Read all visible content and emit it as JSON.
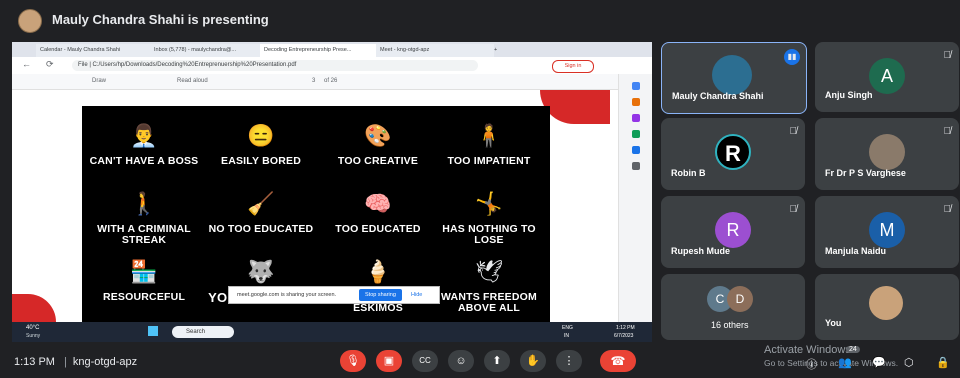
{
  "presenter": {
    "text": "Mauly Chandra Shahi is presenting"
  },
  "browser": {
    "tabs": [
      "Calendar - Mauly Chandra Shahi",
      "Inbox (5,778) - maulychandra@...",
      "Decoding Entrepreneurship Prese...",
      "Meet - kng-otgd-apz"
    ],
    "new_tab": "+",
    "url": "File  |  C:/Users/hp/Downloads/Decoding%20Entreprenuership%20Presentation.pdf",
    "sign_in": "Sign in"
  },
  "pdf_toolbar": {
    "draw": "Draw",
    "read_aloud": "Read aloud",
    "page": "3",
    "of_pages": "of 26"
  },
  "slide": {
    "items": [
      {
        "label": "CAN'T HAVE A BOSS",
        "icon": "👨‍💼"
      },
      {
        "label": "EASILY BORED",
        "icon": "😑"
      },
      {
        "label": "TOO CREATIVE",
        "icon": "🎨"
      },
      {
        "label": "TOO IMPATIENT",
        "icon": "🧍"
      },
      {
        "label": "WITH A CRIMINAL STREAK",
        "icon": "🚶"
      },
      {
        "label": "NO TOO EDUCATED",
        "icon": "🧹"
      },
      {
        "label": "TOO EDUCATED",
        "icon": "🧠"
      },
      {
        "label": "HAS NOTHING TO LOSE",
        "icon": "🤸"
      },
      {
        "label": "RESOURCEFUL",
        "icon": "🏪"
      },
      {
        "label": "YOU'RE A WOLF",
        "icon": "🐺"
      },
      {
        "label": "CREAM TO ESKIMOS",
        "icon": "🍦"
      },
      {
        "label": "WANTS FREEDOM ABOVE ALL",
        "icon": "🕊"
      }
    ]
  },
  "sharing_bar": {
    "text": "meet.google.com is sharing your screen.",
    "stop": "Stop sharing",
    "hide": "Hide"
  },
  "taskbar": {
    "weather_temp": "40°C",
    "weather_desc": "Sunny",
    "search": "Search",
    "lang": "ENG",
    "lang2": "IN",
    "time": "1:12 PM",
    "date": "6/7/2023"
  },
  "participants": [
    {
      "name": "Mauly Chandra Shahi",
      "initial": "",
      "color": "#2c6e91"
    },
    {
      "name": "Anju Singh",
      "initial": "A",
      "color": "#1e6b4f"
    },
    {
      "name": "Robin B",
      "initial": "R",
      "color": "#000000"
    },
    {
      "name": "Fr Dr P S Varghese",
      "initial": "",
      "color": "#8a7a6a"
    },
    {
      "name": "Rupesh Mude",
      "initial": "R",
      "color": "#9c4fd1"
    },
    {
      "name": "Manjula Naidu",
      "initial": "M",
      "color": "#1a5fa8"
    },
    {
      "name": "16 others",
      "initial": "",
      "color": ""
    },
    {
      "name": "You",
      "initial": "",
      "color": "#c9a27a"
    }
  ],
  "others_avatars": [
    "C",
    "D"
  ],
  "bottom": {
    "time": "1:13 PM",
    "separator": "|",
    "meeting_code": "kng-otgd-apz",
    "watermark_1": "Activate Windows",
    "watermark_2": "Go to Settings to activate Windows.",
    "badge": "24"
  }
}
